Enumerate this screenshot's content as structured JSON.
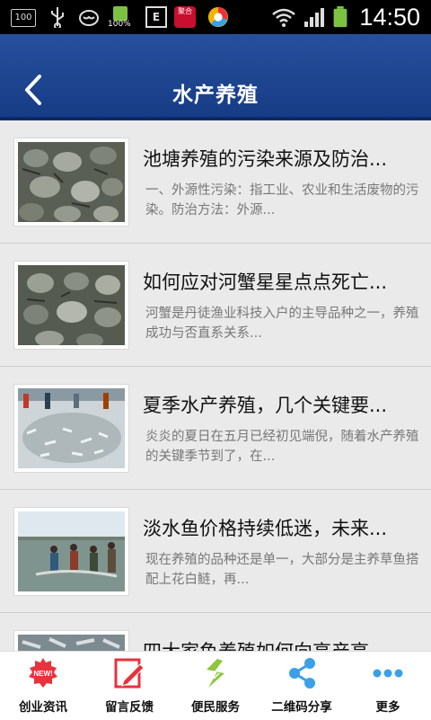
{
  "status_bar": {
    "time": "14:50",
    "battery_label": "100%",
    "storage_label": "100",
    "badge_label": "聚合",
    "keyboard_label": "E"
  },
  "header": {
    "title": "水产养殖"
  },
  "articles": [
    {
      "title": "池塘养殖的污染来源及防治...",
      "desc": "一、外源性污染：指工业、农业和生活废物的污染。防治方法：外源..."
    },
    {
      "title": "如何应对河蟹星星点点死亡...",
      "desc": "河蟹是丹徒渔业科技入户的主导品种之一，养殖成功与否直系关系..."
    },
    {
      "title": "夏季水产养殖，几个关键要...",
      "desc": "炎炎的夏日在五月已经初见端倪，随着水产养殖的关键季节到了，在..."
    },
    {
      "title": "淡水鱼价格持续低迷，未来...",
      "desc": "现在养殖的品种还是单一，大部分是主养草鱼搭配上花白鲢，再..."
    },
    {
      "title": "四大家鱼养殖如何向高产高...",
      "desc": ""
    }
  ],
  "bottom_nav": [
    {
      "label": "创业资讯",
      "icon": "new-badge-icon",
      "badge": "NEW!"
    },
    {
      "label": "留言反馈",
      "icon": "edit-pencil-icon"
    },
    {
      "label": "便民服务",
      "icon": "service-leaf-icon"
    },
    {
      "label": "二维码分享",
      "icon": "share-icon"
    },
    {
      "label": "更多",
      "icon": "more-dots-icon"
    }
  ],
  "colors": {
    "header": "#1f4a96",
    "accent_red": "#e8323c",
    "accent_green": "#8dc63f",
    "accent_blue": "#3aa0e8"
  }
}
